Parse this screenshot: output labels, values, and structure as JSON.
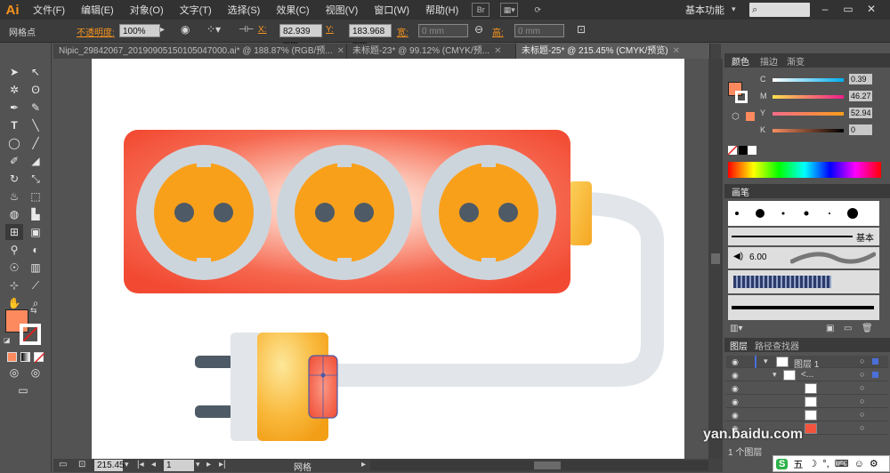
{
  "menubar": {
    "logo": "Ai",
    "items": [
      "文件(F)",
      "编辑(E)",
      "对象(O)",
      "文字(T)",
      "选择(S)",
      "效果(C)",
      "视图(V)",
      "窗口(W)",
      "帮助(H)"
    ],
    "bridge_icon": "Br",
    "workspace": "基本功能",
    "search_placeholder": ""
  },
  "controlbar": {
    "object_label": "网格点",
    "opacity_label": "不透明度:",
    "opacity_value": "100%",
    "x_label": "X:",
    "x_value": "82.939 mm",
    "y_label": "Y:",
    "y_value": "183.968 mm",
    "w_label": "宽:",
    "w_value": "0 mm",
    "h_label": "高:",
    "h_value": "0 mm"
  },
  "tabs": [
    {
      "label": "Nipic_29842067_20190905150105047000.ai* @ 188.87% (RGB/预...",
      "active": false
    },
    {
      "label": "未标题-23* @ 99.12% (CMYK/预...",
      "active": false
    },
    {
      "label": "未标题-25* @ 215.45% (CMYK/预览)",
      "active": true
    }
  ],
  "statusbar": {
    "zoom": "215.45",
    "page": "1",
    "status_text": "网格"
  },
  "color_panel": {
    "tabs": [
      "颜色",
      "描边",
      "渐变"
    ],
    "channels": [
      {
        "label": "C",
        "value": "0.39"
      },
      {
        "label": "M",
        "value": "46.27"
      },
      {
        "label": "Y",
        "value": "52.94"
      },
      {
        "label": "K",
        "value": "0"
      }
    ],
    "fill_color": "#fd8a5e"
  },
  "brush_panel": {
    "tab": "画笔",
    "basic_label": "基本",
    "size_label": "6.00"
  },
  "layers_panel": {
    "tabs": [
      "图层",
      "路径查找器"
    ],
    "layer_name": "图层 1",
    "sublayer_name": "<...",
    "footer": "1 个图层"
  },
  "watermark": "yan.baidu.com",
  "ime": {
    "brand": "S",
    "text": "五"
  },
  "colors": {
    "strip_body": "#f4533e",
    "socket_ring": "#cdd5dc",
    "socket_face": "#f9a01b",
    "hole": "#4e5a65",
    "cable": "#e2e6ea",
    "plug_prong": "#4e5a65",
    "plug_body": "#f6b53a",
    "accent_orange": "#f7941d"
  }
}
